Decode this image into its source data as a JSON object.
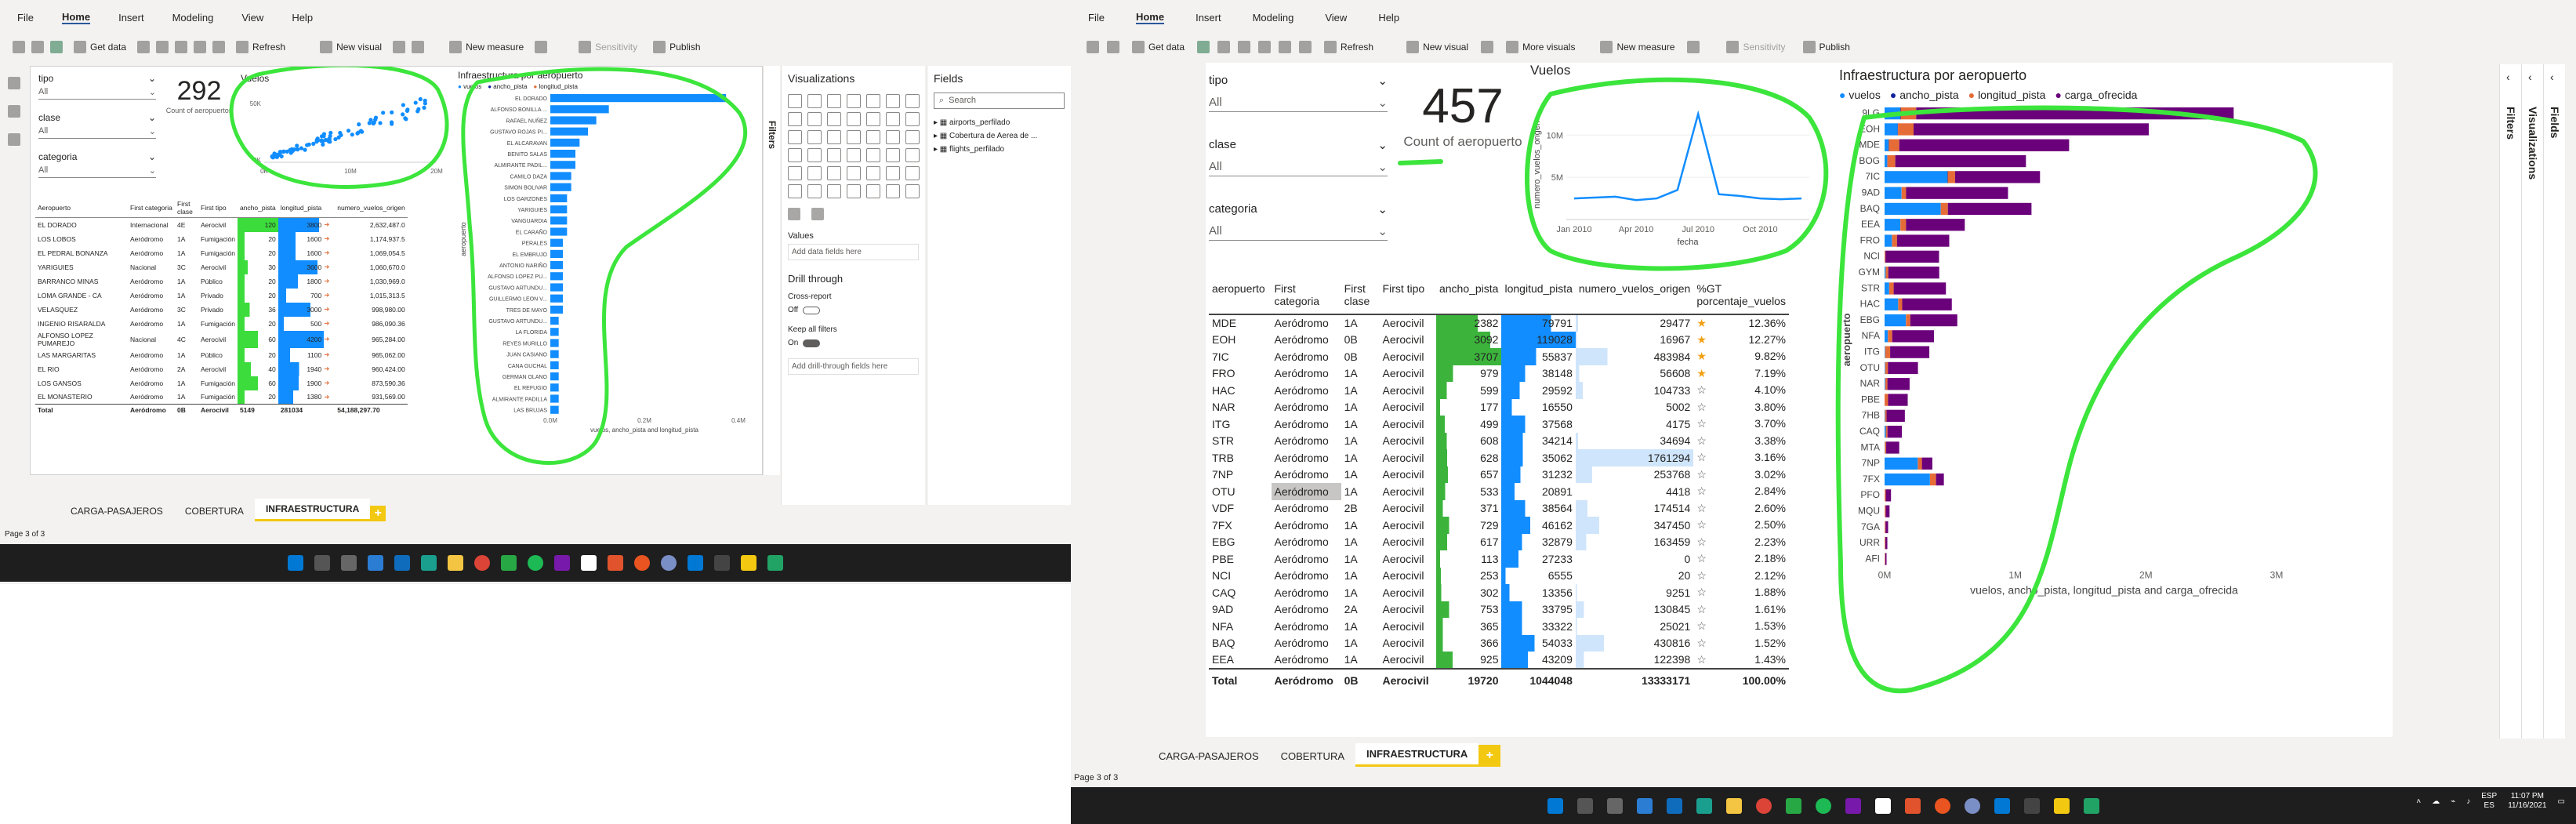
{
  "left_window": {
    "menu": [
      "File",
      "Home",
      "Insert",
      "Modeling",
      "View",
      "Help"
    ],
    "toolbar": {
      "get_data": "Get data",
      "refresh": "Refresh",
      "new_visual": "New visual",
      "new_measure": "New measure",
      "sensitivity": "Sensitivity",
      "publish": "Publish"
    },
    "slicers": [
      {
        "label": "tipo",
        "value": "All"
      },
      {
        "label": "clase",
        "value": "All"
      },
      {
        "label": "categoria",
        "value": "All"
      }
    ],
    "kpi": {
      "value": "292",
      "label": "Count of aeropuertos"
    },
    "scatter": {
      "title": "Vuelos",
      "x_labels": [
        "0K",
        "10M",
        "20M"
      ],
      "y_labels": [
        "50K",
        "0K"
      ]
    },
    "bar": {
      "title": "Infraestructura por aeropuerto",
      "legend": [
        "vuelos",
        "ancho_pista",
        "longitud_pista"
      ],
      "y_title": "aeropuerto",
      "x_axis_title": "vuelos, ancho_pista and longitud_pista",
      "x_labels": [
        "0.0M",
        "0.2M",
        "0.4M"
      ],
      "airports": [
        "EL DORADO",
        "ALFONSO BONILLA ...",
        "RAFAEL NUÑEZ",
        "GUSTAVO ROJAS PI...",
        "EL ALCARAVAN",
        "BENITO SALAS",
        "ALMIRANTE PADIL...",
        "CAMILO DAZA",
        "SIMON BOLIVAR",
        "LOS GARZONES",
        "YARIGUIES",
        "VANGUARDIA",
        "EL CARAÑO",
        "PERALES",
        "EL EMBRUJO",
        "ANTONIO NARIÑO",
        "ALFONSO LOPEZ PU...",
        "GUSTAVO ARTUNDU...",
        "GUILLERMO LEON V...",
        "TRES DE MAYO",
        "GUSTAVO ARTUNDU...",
        "LA FLORIDA",
        "REYES MURILLO",
        "JUAN CASIANO",
        "CANA GUCHAL",
        "GERMAN OLANO",
        "EL REFUGIO",
        "ALMIRANTE PADILLA",
        "LAS BRUJAS"
      ],
      "values": [
        0.42,
        0.14,
        0.11,
        0.09,
        0.07,
        0.06,
        0.06,
        0.05,
        0.05,
        0.04,
        0.04,
        0.04,
        0.04,
        0.03,
        0.03,
        0.03,
        0.03,
        0.03,
        0.03,
        0.03,
        0.02,
        0.02,
        0.02,
        0.02,
        0.02,
        0.02,
        0.02,
        0.02,
        0.02
      ]
    },
    "table": {
      "headers": [
        "Aeropuerto",
        "First categoria",
        "First clase",
        "First tipo",
        "ancho_pista",
        "longitud_pista",
        "",
        "numero_vuelos_origen"
      ],
      "rows": [
        [
          "EL DORADO",
          "Internacional",
          "4E",
          "Aerocivil",
          "120",
          "3800",
          "2,632,487.0"
        ],
        [
          "LOS LOBOS",
          "Aeródromo",
          "1A",
          "Fumigación",
          "20",
          "1600",
          "1,174,937.5"
        ],
        [
          "EL PEDRAL BONANZA",
          "Aeródromo",
          "1A",
          "Fumigación",
          "20",
          "1600",
          "1,069,054.5"
        ],
        [
          "YARIGUIES",
          "Nacional",
          "3C",
          "Aerocivil",
          "30",
          "3600",
          "1,060,670.0"
        ],
        [
          "BARRANCO MINAS",
          "Aeródromo",
          "1A",
          "Público",
          "20",
          "1800",
          "1,030,969.0"
        ],
        [
          "LOMA GRANDE - CA",
          "Aeródromo",
          "1A",
          "Privado",
          "20",
          "700",
          "1,015,313.5"
        ],
        [
          "VELASQUEZ",
          "Aeródromo",
          "3C",
          "Privado",
          "36",
          "3000",
          "998,980.00"
        ],
        [
          "INGENIO RISARALDA",
          "Aeródromo",
          "1A",
          "Fumigación",
          "20",
          "500",
          "986,090.36"
        ],
        [
          "ALFONSO LOPEZ PUMAREJO",
          "Nacional",
          "4C",
          "Aerocivil",
          "60",
          "4200",
          "965,284.00"
        ],
        [
          "LAS MARGARITAS",
          "Aeródromo",
          "1A",
          "Público",
          "20",
          "1100",
          "965,062.00"
        ],
        [
          "EL RIO",
          "Aeródromo",
          "2A",
          "Aerocivil",
          "40",
          "1940",
          "960,424.00"
        ],
        [
          "LOS GANSOS",
          "Aeródromo",
          "1A",
          "Fumigación",
          "60",
          "1900",
          "873,590.36"
        ],
        [
          "EL MONASTERIO",
          "Aeródromo",
          "1A",
          "Fumigación",
          "20",
          "1380",
          "931,569.00"
        ]
      ],
      "total": [
        "Total",
        "Aeródromo",
        "0B",
        "Aerocivil",
        "5149",
        "281034",
        "54,188,297.70"
      ]
    },
    "tabs": [
      "CARGA-PASAJEROS",
      "COBERTURA",
      "INFRAESTRUCTURA"
    ],
    "status": "Page 3 of 3",
    "visualizations": {
      "title": "Visualizations",
      "values": "Values",
      "add_data": "Add data fields here",
      "drill": "Drill through",
      "cross": "Cross-report",
      "off": "Off",
      "keep": "Keep all filters",
      "on": "On",
      "add_drill": "Add drill-through fields here"
    },
    "fields": {
      "title": "Fields",
      "search": "Search",
      "items": [
        "airports_perfilado",
        "Cobertura de Aerea de ...",
        "flights_perfilado"
      ]
    },
    "filters": "Filters"
  },
  "right_window": {
    "menu": [
      "File",
      "Home",
      "Insert",
      "Modeling",
      "View",
      "Help"
    ],
    "toolbar": {
      "get_data": "Get data",
      "refresh": "Refresh",
      "new_visual": "New visual",
      "more_visuals": "More visuals",
      "new_measure": "New measure",
      "sensitivity": "Sensitivity",
      "publish": "Publish"
    },
    "slicers": [
      {
        "label": "tipo",
        "value": "All"
      },
      {
        "label": "clase",
        "value": "All"
      },
      {
        "label": "categoria",
        "value": "All"
      }
    ],
    "kpi": {
      "value": "457",
      "label": "Count of aeropuerto"
    },
    "line": {
      "title": "Vuelos",
      "y_title": "numero_vuelos_origen",
      "x_title": "fecha",
      "x_labels": [
        "Jan 2010",
        "Apr 2010",
        "Jul 2010",
        "Oct 2010"
      ],
      "y_labels": [
        "10M",
        "5M"
      ]
    },
    "bar": {
      "title": "Infraestructura por aeropuerto",
      "legend": [
        "vuelos",
        "ancho_pista",
        "longitud_pista",
        "carga_ofrecida"
      ],
      "y_title": "aeropuerto",
      "x_axis_title": "vuelos, ancho_pista, longitud_pista and carga_ofrecida",
      "x_labels": [
        "0M",
        "1M",
        "2M",
        "3M"
      ]
    },
    "table": {
      "headers": [
        "aeropuerto",
        "First categoria",
        "First clase",
        "First tipo",
        "ancho_pista",
        "longitud_pista",
        "numero_vuelos_origen",
        "%GT porcentaje_vuelos"
      ],
      "rows": [
        [
          "MDE",
          "Aeródromo",
          "1A",
          "Aerocivil",
          "2382",
          "79791",
          "29477",
          "12.36%"
        ],
        [
          "EOH",
          "Aeródromo",
          "0B",
          "Aerocivil",
          "3092",
          "119028",
          "16967",
          "12.27%"
        ],
        [
          "7IC",
          "Aeródromo",
          "0B",
          "Aerocivil",
          "3707",
          "55837",
          "483984",
          "9.82%"
        ],
        [
          "FRO",
          "Aeródromo",
          "1A",
          "Aerocivil",
          "979",
          "38148",
          "56608",
          "7.19%"
        ],
        [
          "HAC",
          "Aeródromo",
          "1A",
          "Aerocivil",
          "599",
          "29592",
          "104733",
          "4.10%"
        ],
        [
          "NAR",
          "Aeródromo",
          "1A",
          "Aerocivil",
          "177",
          "16550",
          "5002",
          "3.80%"
        ],
        [
          "ITG",
          "Aeródromo",
          "1A",
          "Aerocivil",
          "499",
          "37568",
          "4175",
          "3.70%"
        ],
        [
          "STR",
          "Aeródromo",
          "1A",
          "Aerocivil",
          "608",
          "34214",
          "34694",
          "3.38%"
        ],
        [
          "TRB",
          "Aeródromo",
          "1A",
          "Aerocivil",
          "628",
          "35062",
          "1761294",
          "3.16%"
        ],
        [
          "7NP",
          "Aeródromo",
          "1A",
          "Aerocivil",
          "657",
          "31232",
          "253768",
          "3.02%"
        ],
        [
          "OTU",
          "Aeródromo",
          "1A",
          "Aerocivil",
          "533",
          "20891",
          "4418",
          "2.84%"
        ],
        [
          "VDF",
          "Aeródromo",
          "2B",
          "Aerocivil",
          "371",
          "38564",
          "174514",
          "2.60%"
        ],
        [
          "7FX",
          "Aeródromo",
          "1A",
          "Aerocivil",
          "729",
          "46162",
          "347450",
          "2.50%"
        ],
        [
          "EBG",
          "Aeródromo",
          "1A",
          "Aerocivil",
          "617",
          "32879",
          "163459",
          "2.23%"
        ],
        [
          "PBE",
          "Aeródromo",
          "1A",
          "Aerocivil",
          "113",
          "27233",
          "0",
          "2.18%"
        ],
        [
          "NCI",
          "Aeródromo",
          "1A",
          "Aerocivil",
          "253",
          "6555",
          "20",
          "2.12%"
        ],
        [
          "CAQ",
          "Aeródromo",
          "1A",
          "Aerocivil",
          "302",
          "13356",
          "9251",
          "1.88%"
        ],
        [
          "9AD",
          "Aeródromo",
          "2A",
          "Aerocivil",
          "753",
          "33795",
          "130845",
          "1.61%"
        ],
        [
          "NFA",
          "Aeródromo",
          "1A",
          "Aerocivil",
          "365",
          "33322",
          "25021",
          "1.53%"
        ],
        [
          "BAQ",
          "Aeródromo",
          "1A",
          "Aerocivil",
          "366",
          "54033",
          "430816",
          "1.52%"
        ],
        [
          "EEA",
          "Aeródromo",
          "1A",
          "Aerocivil",
          "925",
          "43209",
          "122398",
          "1.43%"
        ]
      ],
      "total": [
        "Total",
        "Aeródromo",
        "0B",
        "Aerocivil",
        "19720",
        "1044048",
        "13333171",
        "100.00%"
      ]
    },
    "tabs": [
      "CARGA-PASAJEROS",
      "COBERTURA",
      "INFRAESTRUCTURA"
    ],
    "status": "Page 3 of 3",
    "filters": "Filters",
    "visualizations": "Visualizations",
    "fields": "Fields",
    "tray": {
      "lang": "ESP",
      "region": "ES",
      "time": "11:07 PM",
      "date": "11/16/2021"
    }
  },
  "chart_data": [
    {
      "type": "bar",
      "title": "Infraestructura por aeropuerto",
      "ylabel": "aeropuerto",
      "xlabel": "vuelos, ancho_pista, longitud_pista and carga_ofrecida",
      "xlim": [
        0,
        3000000
      ],
      "categories": [
        "9LG",
        "EOH",
        "MDE",
        "BOG",
        "7IC",
        "9AD",
        "BAQ",
        "EEA",
        "FRO",
        "NCI",
        "GYM",
        "STR",
        "HAC",
        "EBG",
        "NFA",
        "ITG",
        "OTU",
        "NAR",
        "PBE",
        "7HB",
        "CAQ",
        "MTA",
        "7NP",
        "7FX",
        "PFO",
        "MQU",
        "7GA",
        "URR",
        "AFI"
      ],
      "series": [
        {
          "name": "vuelos",
          "values": [
            120000,
            100000,
            30000,
            20000,
            480000,
            130000,
            430000,
            120000,
            56000,
            20,
            8000,
            35000,
            104000,
            163000,
            25000,
            4000,
            4000,
            5000,
            0,
            3000,
            9000,
            2000,
            254000,
            347000,
            1000,
            1000,
            1000,
            1000,
            1000
          ]
        },
        {
          "name": "ancho_pista",
          "values": [
            3000,
            3000,
            2400,
            2000,
            3700,
            750,
            370,
            930,
            980,
            250,
            300,
            600,
            600,
            620,
            370,
            500,
            530,
            180,
            110,
            200,
            300,
            200,
            660,
            730,
            150,
            150,
            150,
            150,
            150
          ]
        },
        {
          "name": "longitud_pista",
          "values": [
            119000,
            119000,
            80000,
            60000,
            56000,
            34000,
            54000,
            43000,
            38000,
            6500,
            20000,
            34000,
            30000,
            33000,
            33000,
            38000,
            21000,
            16500,
            27000,
            12000,
            13000,
            10000,
            31000,
            46000,
            8000,
            7000,
            6000,
            5000,
            4000
          ]
        },
        {
          "name": "carga_ofrecida",
          "values": [
            2430000,
            1800000,
            1300000,
            1000000,
            650000,
            780000,
            640000,
            450000,
            400000,
            410000,
            390000,
            400000,
            380000,
            360000,
            320000,
            300000,
            230000,
            170000,
            150000,
            140000,
            110000,
            100000,
            80000,
            60000,
            40000,
            30000,
            20000,
            15000,
            10000
          ]
        }
      ],
      "legend": "top-left"
    },
    {
      "type": "line",
      "title": "Vuelos",
      "xlabel": "fecha",
      "ylabel": "numero_vuelos_origen",
      "x": [
        "Jan 2010",
        "Feb 2010",
        "Mar 2010",
        "Apr 2010",
        "May 2010",
        "Jun 2010",
        "Jul 2010",
        "Aug 2010",
        "Sep 2010",
        "Oct 2010",
        "Nov 2010",
        "Dec 2010"
      ],
      "series": [
        {
          "values": [
            2500000,
            2600000,
            2700000,
            2300000,
            2500000,
            3500000,
            12500000,
            3000000,
            2800000,
            2500000,
            2400000,
            2500000
          ]
        }
      ],
      "ylim": [
        0,
        13000000
      ]
    }
  ],
  "colors": {
    "green_annot": "#3ce53c",
    "accent_blue": "#118dff",
    "purple": "#6b007b",
    "orange": "#e66c37",
    "yellow": "#f2c811",
    "taskbar": "#1e1e1e"
  }
}
